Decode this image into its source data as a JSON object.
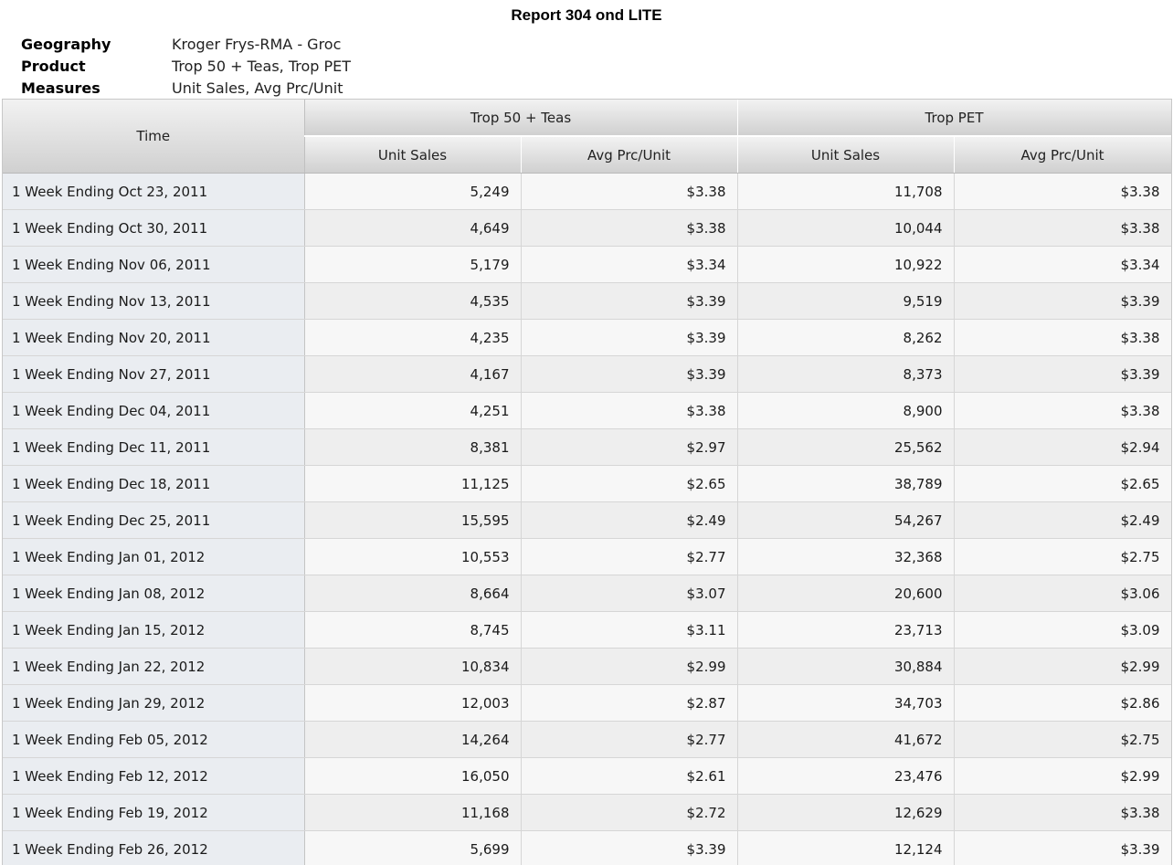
{
  "report": {
    "title": "Report 304 ond LITE",
    "meta": [
      {
        "label": "Geography",
        "value": "Kroger Frys-RMA - Groc"
      },
      {
        "label": "Product",
        "value": "Trop 50 + Teas, Trop PET"
      },
      {
        "label": "Measures",
        "value": "Unit Sales, Avg Prc/Unit"
      }
    ]
  },
  "table": {
    "time_header": "Time",
    "groups": [
      "Trop 50 + Teas",
      "Trop PET"
    ],
    "measures": [
      "Unit Sales",
      "Avg Prc/Unit",
      "Unit Sales",
      "Avg Prc/Unit"
    ],
    "rows": [
      [
        "1 Week Ending Oct 23, 2011",
        "5,249",
        "$3.38",
        "11,708",
        "$3.38"
      ],
      [
        "1 Week Ending Oct 30, 2011",
        "4,649",
        "$3.38",
        "10,044",
        "$3.38"
      ],
      [
        "1 Week Ending Nov 06, 2011",
        "5,179",
        "$3.34",
        "10,922",
        "$3.34"
      ],
      [
        "1 Week Ending Nov 13, 2011",
        "4,535",
        "$3.39",
        "9,519",
        "$3.39"
      ],
      [
        "1 Week Ending Nov 20, 2011",
        "4,235",
        "$3.39",
        "8,262",
        "$3.38"
      ],
      [
        "1 Week Ending Nov 27, 2011",
        "4,167",
        "$3.39",
        "8,373",
        "$3.39"
      ],
      [
        "1 Week Ending Dec 04, 2011",
        "4,251",
        "$3.38",
        "8,900",
        "$3.38"
      ],
      [
        "1 Week Ending Dec 11, 2011",
        "8,381",
        "$2.97",
        "25,562",
        "$2.94"
      ],
      [
        "1 Week Ending Dec 18, 2011",
        "11,125",
        "$2.65",
        "38,789",
        "$2.65"
      ],
      [
        "1 Week Ending Dec 25, 2011",
        "15,595",
        "$2.49",
        "54,267",
        "$2.49"
      ],
      [
        "1 Week Ending Jan 01, 2012",
        "10,553",
        "$2.77",
        "32,368",
        "$2.75"
      ],
      [
        "1 Week Ending Jan 08, 2012",
        "8,664",
        "$3.07",
        "20,600",
        "$3.06"
      ],
      [
        "1 Week Ending Jan 15, 2012",
        "8,745",
        "$3.11",
        "23,713",
        "$3.09"
      ],
      [
        "1 Week Ending Jan 22, 2012",
        "10,834",
        "$2.99",
        "30,884",
        "$2.99"
      ],
      [
        "1 Week Ending Jan 29, 2012",
        "12,003",
        "$2.87",
        "34,703",
        "$2.86"
      ],
      [
        "1 Week Ending Feb 05, 2012",
        "14,264",
        "$2.77",
        "41,672",
        "$2.75"
      ],
      [
        "1 Week Ending Feb 12, 2012",
        "16,050",
        "$2.61",
        "23,476",
        "$2.99"
      ],
      [
        "1 Week Ending Feb 19, 2012",
        "11,168",
        "$2.72",
        "12,629",
        "$3.38"
      ],
      [
        "1 Week Ending Feb 26, 2012",
        "5,699",
        "$3.39",
        "12,124",
        "$3.39"
      ]
    ]
  }
}
